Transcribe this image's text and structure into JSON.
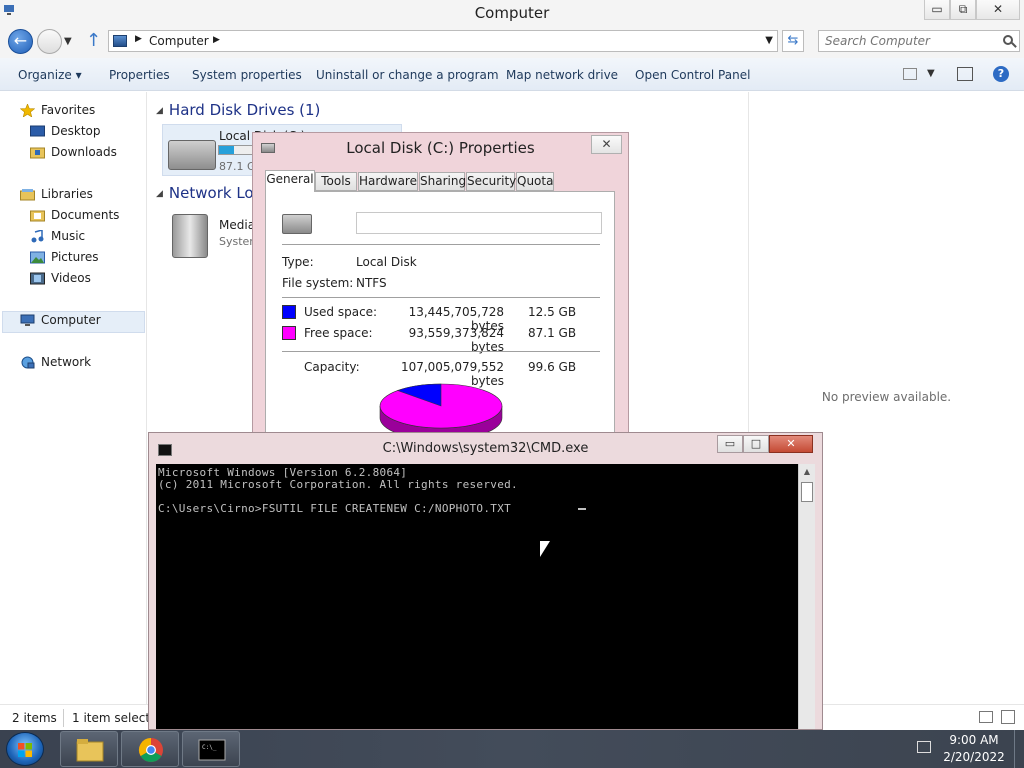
{
  "explorer": {
    "title": "Computer",
    "window_controls": {
      "minimize": "▭",
      "maximize": "⧉",
      "close": "✕"
    },
    "address": {
      "crumb": "Computer"
    },
    "search": {
      "placeholder": "Search Computer"
    },
    "commands": [
      "Organize ▾",
      "Properties",
      "System properties",
      "Uninstall or change a program",
      "Map network drive",
      "Open Control Panel"
    ],
    "nav": {
      "favorites": "Favorites",
      "desktop": "Desktop",
      "downloads": "Downloads",
      "libraries": "Libraries",
      "documents": "Documents",
      "music": "Music",
      "pictures": "Pictures",
      "videos": "Videos",
      "computer": "Computer",
      "network": "Network"
    },
    "groups": {
      "hard_disk": "Hard Disk Drives (1)",
      "network_loc": "Network Loc"
    },
    "drive": {
      "name": "Local Disk (C:)",
      "free_text": "87.1 G",
      "used_fraction": 0.13
    },
    "media": {
      "name": "Media",
      "sub": "System"
    },
    "preview_text": "No preview available.",
    "status": {
      "items": "2 items",
      "selected": "1 item selected"
    }
  },
  "props": {
    "title": "Local Disk (C:) Properties",
    "close": "✕",
    "tabs": [
      "General",
      "Tools",
      "Hardware",
      "Sharing",
      "Security",
      "Quota"
    ],
    "label_value": "",
    "type_label": "Type:",
    "type_value": "Local Disk",
    "fs_label": "File system:",
    "fs_value": "NTFS",
    "used_label": "Used space:",
    "used_bytes": "13,445,705,728 bytes",
    "used_gb": "12.5 GB",
    "free_label": "Free space:",
    "free_bytes": "93,559,373,824 bytes",
    "free_gb": "87.1 GB",
    "cap_label": "Capacity:",
    "cap_bytes": "107,005,079,552 bytes",
    "cap_gb": "99.6 GB",
    "colors": {
      "used": "#0000ff",
      "free": "#ff00ff"
    },
    "used_fraction": 0.126
  },
  "cmd": {
    "title": "C:\\Windows\\system32\\CMD.exe",
    "minimize": "▭",
    "maximize": "□",
    "close": "✕",
    "lines": [
      "Microsoft Windows [Version 6.2.8064]",
      "(c) 2011 Microsoft Corporation. All rights reserved.",
      "",
      "C:\\Users\\Cirno>FSUTIL FILE CREATENEW C:/NOPHOTO.TXT"
    ]
  },
  "taskbar": {
    "time": "9:00 AM",
    "date": "2/20/2022",
    "apps": [
      "file-explorer-icon",
      "chrome-icon",
      "cmd-icon"
    ]
  }
}
